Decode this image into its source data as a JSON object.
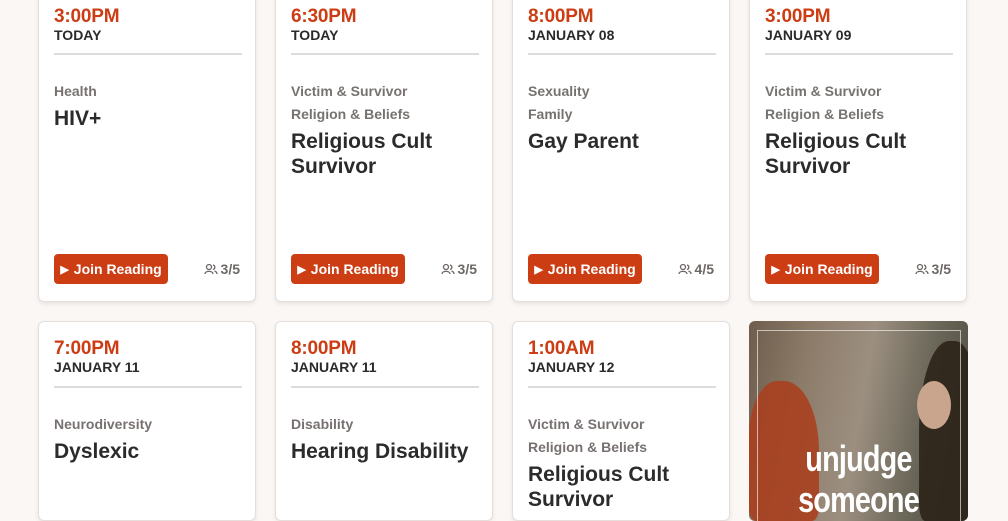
{
  "accent_color": "#cc3d14",
  "join_label": "Join Reading",
  "cards": [
    {
      "time": "3:00PM",
      "date": "TODAY",
      "tags": [
        "Health"
      ],
      "title": "HIV+",
      "count": "3/5"
    },
    {
      "time": "6:30PM",
      "date": "TODAY",
      "tags": [
        "Victim & Survivor",
        "Religion & Beliefs"
      ],
      "title": "Religious Cult Survivor",
      "count": "3/5"
    },
    {
      "time": "8:00PM",
      "date": "JANUARY 08",
      "tags": [
        "Sexuality",
        "Family"
      ],
      "title": "Gay Parent",
      "count": "4/5"
    },
    {
      "time": "3:00PM",
      "date": "JANUARY 09",
      "tags": [
        "Victim & Survivor",
        "Religion & Beliefs"
      ],
      "title": "Religious Cult Survivor",
      "count": "3/5"
    },
    {
      "time": "7:00PM",
      "date": "JANUARY 11",
      "tags": [
        "Neurodiversity"
      ],
      "title": "Dyslexic"
    },
    {
      "time": "8:00PM",
      "date": "JANUARY 11",
      "tags": [
        "Disability"
      ],
      "title": "Hearing Disability"
    },
    {
      "time": "1:00AM",
      "date": "JANUARY 12",
      "tags": [
        "Victim & Survivor",
        "Religion & Beliefs"
      ],
      "title": "Religious Cult Survivor"
    }
  ],
  "promo": {
    "line1": "unjudge",
    "line2": "someone"
  }
}
